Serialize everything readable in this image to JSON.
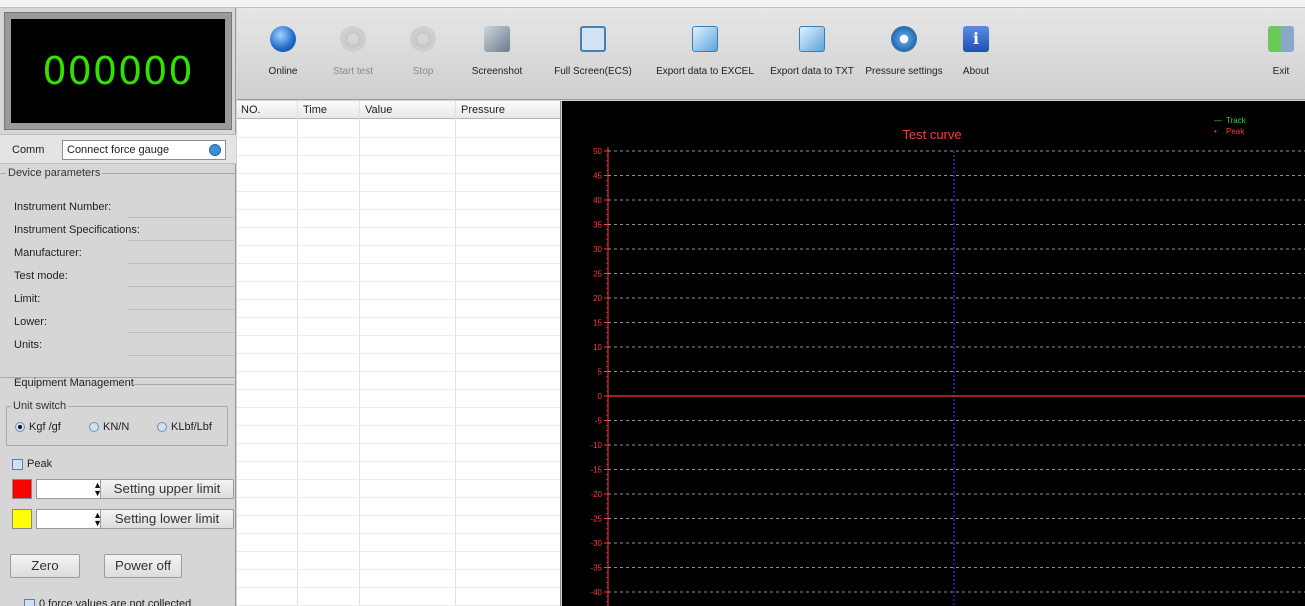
{
  "lcd": {
    "value": "000000"
  },
  "comm": {
    "label": "Comm",
    "selected": "Connect force gauge"
  },
  "device_params": {
    "title": "Device parameters",
    "fields": [
      {
        "label": "Instrument Number:",
        "value": ""
      },
      {
        "label": "Instrument Specifications:",
        "value": ""
      },
      {
        "label": "Manufacturer:",
        "value": ""
      },
      {
        "label": "Test mode:",
        "value": ""
      },
      {
        "label": "Limit:",
        "value": ""
      },
      {
        "label": "Lower:",
        "value": ""
      },
      {
        "label": "Units:",
        "value": ""
      }
    ]
  },
  "equipment": {
    "title": "Equipment Management",
    "unit_switch": {
      "title": "Unit switch",
      "options": [
        {
          "label": "Kgf /gf",
          "selected": true
        },
        {
          "label": "KN/N",
          "selected": false
        },
        {
          "label": "KLbf/Lbf",
          "selected": false
        }
      ]
    },
    "peak_label": "Peak",
    "upper_limit_button": "Setting upper limit",
    "lower_limit_button": "Setting lower limit",
    "upper_color": "#ff0000",
    "lower_color": "#ffff00",
    "zero_button": "Zero",
    "power_button": "Power off",
    "not_collected_label": "0 force values are not collected"
  },
  "toolbar": {
    "buttons": [
      {
        "label": "Online",
        "icon": "globe-icon",
        "enabled": true
      },
      {
        "label": "Start test",
        "icon": "gears-icon",
        "enabled": false
      },
      {
        "label": "Stop",
        "icon": "gears-stop-icon",
        "enabled": false
      },
      {
        "label": "Screenshot",
        "icon": "camera-icon",
        "enabled": true
      },
      {
        "label": "Full Screen(ECS)",
        "icon": "fullscreen-icon",
        "enabled": true
      },
      {
        "label": "Export data to EXCEL",
        "icon": "export-excel-icon",
        "enabled": true
      },
      {
        "label": "Export data to TXT",
        "icon": "export-txt-icon",
        "enabled": true
      },
      {
        "label": "Pressure settings",
        "icon": "settings-icon",
        "enabled": true
      },
      {
        "label": "About",
        "icon": "info-icon",
        "enabled": true
      },
      {
        "label": "Exit",
        "icon": "exit-icon",
        "enabled": true
      }
    ]
  },
  "table": {
    "columns": [
      "NO.",
      "Time",
      "Value",
      "Pressure"
    ],
    "rows": []
  },
  "chart_data": {
    "type": "line",
    "title": "Test curve",
    "legend": [
      "Track",
      "Peak"
    ],
    "legend_position": "top-right",
    "y_ticks": [
      50,
      45,
      40,
      35,
      30,
      25,
      20,
      15,
      10,
      5,
      0,
      -5,
      -10,
      -15,
      -20,
      -25,
      -30,
      -35,
      -40
    ],
    "ylim": [
      -40,
      50
    ],
    "series": [
      {
        "name": "Track",
        "color": "#ff3030",
        "y_value": 0
      }
    ],
    "grid": true,
    "colors": {
      "background": "#000000",
      "title": "#ff3a3a",
      "axis": "#ff3a3a",
      "grid": "#bfbfbf",
      "cursor": "#3040ff",
      "track": "#33d033",
      "peak": "#ff3a3a"
    }
  }
}
